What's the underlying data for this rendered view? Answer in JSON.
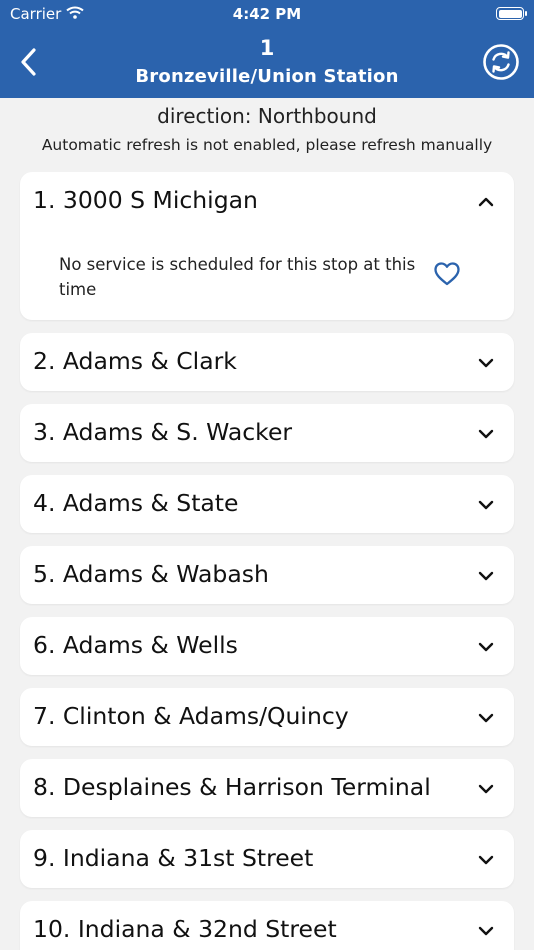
{
  "status_bar": {
    "carrier": "Carrier",
    "time": "4:42 PM"
  },
  "header": {
    "route_number": "1",
    "route_name": "Bronzeville/Union Station"
  },
  "direction": "direction: Northbound",
  "refresh_note": "Automatic refresh is not enabled, please refresh manually",
  "stops": [
    {
      "label": "1. 3000 S Michigan",
      "expanded": true,
      "message": "No service is scheduled for this stop at this time"
    },
    {
      "label": "2. Adams & Clark",
      "expanded": false
    },
    {
      "label": "3. Adams & S. Wacker",
      "expanded": false
    },
    {
      "label": "4. Adams & State",
      "expanded": false
    },
    {
      "label": "5. Adams & Wabash",
      "expanded": false
    },
    {
      "label": "6. Adams & Wells",
      "expanded": false
    },
    {
      "label": "7. Clinton & Adams/Quincy",
      "expanded": false
    },
    {
      "label": "8. Desplaines & Harrison Terminal",
      "expanded": false
    },
    {
      "label": "9. Indiana & 31st Street",
      "expanded": false
    },
    {
      "label": "10. Indiana & 32nd Street",
      "expanded": false
    }
  ],
  "icons": {
    "back": "chevron-left-icon",
    "refresh": "refresh-circle-icon",
    "expand": "chevron-down-icon",
    "collapse": "chevron-up-icon",
    "favorite": "heart-outline-icon"
  },
  "colors": {
    "header": "#2b63ad",
    "accent": "#2b63ad",
    "background": "#f2f2f2",
    "card": "#ffffff"
  }
}
